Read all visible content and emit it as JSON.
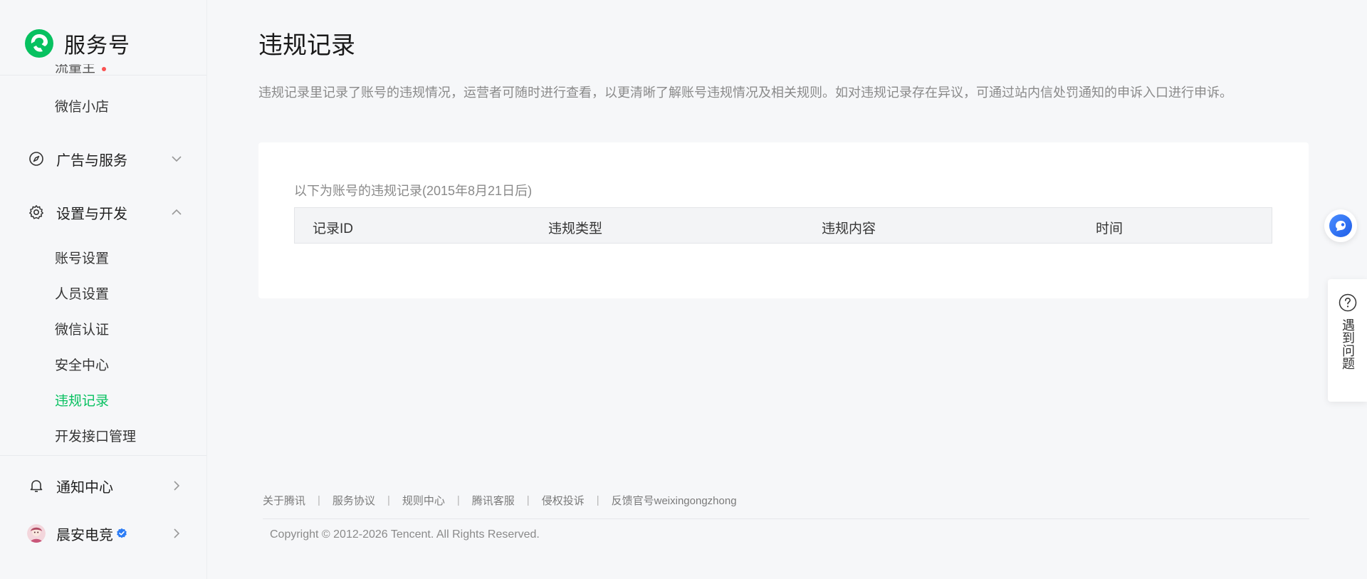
{
  "brand": {
    "name": "服务号"
  },
  "sidebar": {
    "cut_item": "流量主",
    "item_wechat_shop": "微信小店",
    "group_ads": "广告与服务",
    "group_settings": "设置与开发",
    "settings_items": [
      "账号设置",
      "人员设置",
      "微信认证",
      "安全中心",
      "违规记录",
      "开发接口管理"
    ],
    "active_item": "违规记录",
    "group_notify": "通知中心",
    "account_name": "晨安电竞"
  },
  "main": {
    "title": "违规记录",
    "description": "违规记录里记录了账号的违规情况，运营者可随时进行查看，以更清晰了解账号违规情况及相关规则。如对违规记录存在异议，可通过站内信处罚通知的申诉入口进行申诉。",
    "card_caption": "以下为账号的违规记录(2015年8月21日后)",
    "table_headers": [
      "记录ID",
      "违规类型",
      "违规内容",
      "时间"
    ]
  },
  "footer": {
    "links": [
      "关于腾讯",
      "服务协议",
      "规则中心",
      "腾讯客服",
      "侵权投诉",
      "反馈官号weixingongzhong"
    ],
    "separator": "|",
    "copyright": "Copyright © 2012-2026 Tencent. All Rights Reserved."
  },
  "help": {
    "label": "遇到问题"
  },
  "colors": {
    "brand_green": "#07c160",
    "active_text": "#07c160",
    "float_blue": "#2b6cf6"
  },
  "icons": {
    "logo": "wechat-service-logo-icon",
    "ads": "compass-icon",
    "settings": "gear-icon",
    "notify": "bell-icon",
    "chevron_down": "chevron-down-icon",
    "chevron_up": "chevron-up-icon",
    "chevron_right": "chevron-right-icon",
    "help": "question-circle-icon"
  }
}
